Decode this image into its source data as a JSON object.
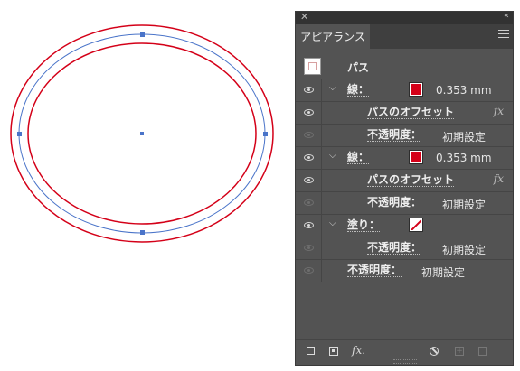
{
  "panel": {
    "tab_label": "アピアランス",
    "target_label": "パス",
    "rows": [
      {
        "name": "row-stroke-1",
        "eye": "on",
        "chevron": "⌵",
        "label": "線：",
        "swatch": "red",
        "value": "0.353 mm"
      },
      {
        "name": "row-offset-1",
        "eye": "on",
        "label": "パスのオフセット",
        "fx": "fx"
      },
      {
        "name": "row-opacity-1",
        "eye": "off",
        "label": "不透明度：",
        "value": "初期設定"
      },
      {
        "name": "row-stroke-2",
        "eye": "on",
        "chevron": "⌵",
        "label": "線：",
        "swatch": "red",
        "value": "0.353 mm"
      },
      {
        "name": "row-offset-2",
        "eye": "on",
        "label": "パスのオフセット",
        "fx": "fx"
      },
      {
        "name": "row-opacity-2",
        "eye": "off",
        "label": "不透明度：",
        "value": "初期設定"
      },
      {
        "name": "row-fill",
        "eye": "on",
        "chevron": "⌵",
        "label": "塗り：",
        "swatch": "none"
      },
      {
        "name": "row-opacity-3",
        "eye": "off",
        "label": "不透明度：",
        "value": "初期設定"
      },
      {
        "name": "row-opacity-object",
        "eye": "off",
        "label": "不透明度：",
        "value": "初期設定"
      }
    ],
    "footer": {
      "fx_label": "fx."
    }
  },
  "colors": {
    "stroke": "#d40018",
    "path": "#4a74c9",
    "panel_bg": "#535353"
  }
}
